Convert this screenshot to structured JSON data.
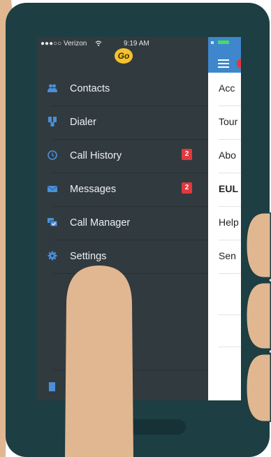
{
  "colors": {
    "phone_body": "#1d3e42",
    "sidebar_bg": "#313a3f",
    "accent_blue": "#3e87cc",
    "badge_red": "#e2383e",
    "skin": "#e1b791"
  },
  "status_bar": {
    "carrier": "●●●○○ Verizon",
    "wifi_icon": "wifi-icon",
    "time": "9:19 AM"
  },
  "logo": {
    "text": "Go"
  },
  "menu": {
    "items": [
      {
        "label": "Contacts",
        "icon": "contacts-icon",
        "badge": ""
      },
      {
        "label": "Dialer",
        "icon": "dialer-icon",
        "badge": ""
      },
      {
        "label": "Call History",
        "icon": "clock-icon",
        "badge": "2"
      },
      {
        "label": "Messages",
        "icon": "envelope-icon",
        "badge": "2"
      },
      {
        "label": "Call Manager",
        "icon": "call-manager-icon",
        "badge": ""
      },
      {
        "label": "Settings",
        "icon": "gear-icon",
        "badge": ""
      }
    ]
  },
  "content_panel": {
    "rows": [
      "Acc",
      "Tour",
      "Abo",
      "EUL",
      "Help",
      "Sen"
    ]
  }
}
